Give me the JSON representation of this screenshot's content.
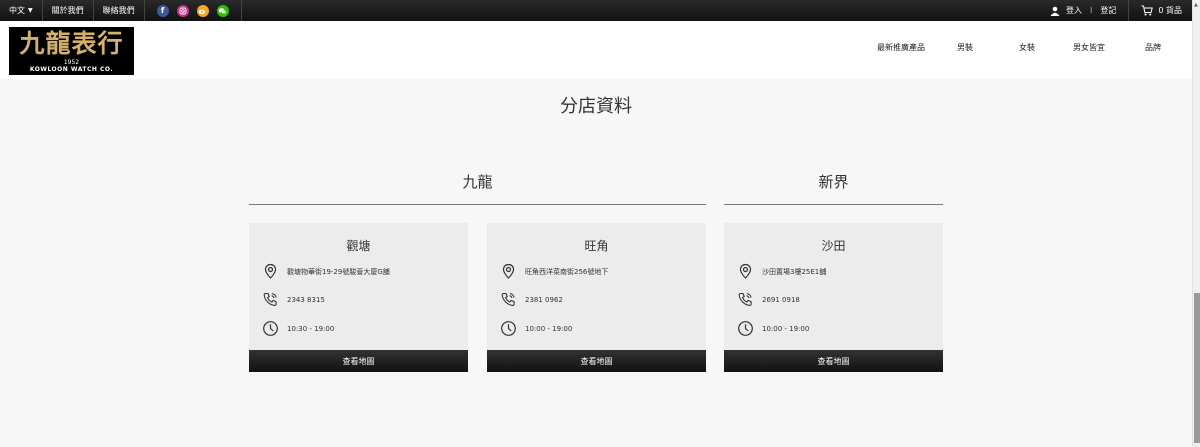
{
  "topbar": {
    "language": "中文",
    "about": "關於我們",
    "contact": "聯絡我們",
    "social": [
      "facebook-icon",
      "instagram-icon",
      "weibo-icon",
      "wechat-icon"
    ],
    "login": "登入",
    "separator": "I",
    "register": "登記",
    "cart": "0 貨品"
  },
  "header": {
    "logo": {
      "chinese": "九龍表行",
      "year": "1952",
      "english": "KOWLOON WATCH CO."
    },
    "nav": [
      "最新推廣產品",
      "男裝",
      "女裝",
      "男女皆宜",
      "品牌"
    ]
  },
  "page": {
    "title": "分店資料"
  },
  "regions": [
    {
      "name": "九龍"
    },
    {
      "name": "新界"
    }
  ],
  "stores": [
    {
      "name": "觀塘",
      "address": "觀塘物華街19-29號駿薈大廈G舖",
      "phone": "2343 8315",
      "hours": "10:30 - 19:00",
      "button": "查看地圖"
    },
    {
      "name": "旺角",
      "address": "旺角西洋菜南街256號地下",
      "phone": "2381 0962",
      "hours": "10:00 - 19:00",
      "button": "查看地圖"
    },
    {
      "name": "沙田",
      "address": "沙田置場3樓25E1舖",
      "phone": "2691 0918",
      "hours": "10:00 - 19:00",
      "button": "查看地圖"
    }
  ],
  "colors": {
    "topbar": "#111111",
    "logo_gold": "#d4b06a",
    "card_bg": "#ececec",
    "button_bg": "#1a1a1a"
  }
}
